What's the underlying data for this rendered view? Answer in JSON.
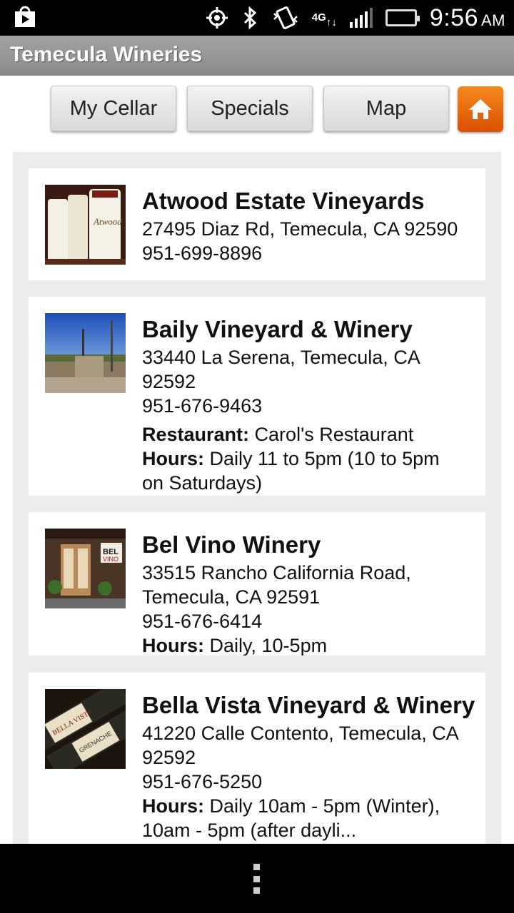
{
  "status_bar": {
    "time": "9:56",
    "ampm": "AM",
    "network": "4G",
    "icons": [
      "play-store-icon",
      "gps-icon",
      "bluetooth-icon",
      "vibrate-icon",
      "4g-icon",
      "signal-icon",
      "battery-icon"
    ],
    "battery_color": "#46c11d"
  },
  "app": {
    "title": "Temecula Wineries"
  },
  "toolbar": {
    "my_cellar": "My Cellar",
    "specials": "Specials",
    "map": "Map",
    "home_icon": "home-icon",
    "home_color": "#e8650c"
  },
  "wineries": [
    {
      "name": "Atwood Estate Vineyards",
      "address_line1": "27495 Diaz Rd, Temecula, CA 92590",
      "phone": "951-699-8896"
    },
    {
      "name": "Baily Vineyard & Winery",
      "address_line1": "33440 La Serena, Temecula, CA",
      "address_line2": "92592",
      "phone": "951-676-9463",
      "restaurant_label": "Restaurant:",
      "restaurant": "Carol's Restaurant",
      "hours_label": "Hours:",
      "hours_line1": "Daily 11 to 5pm (10 to 5pm",
      "hours_line2": "on Saturdays)"
    },
    {
      "name": "Bel Vino Winery",
      "address_line1": "33515 Rancho California Road,",
      "address_line2": "Temecula, CA 92591",
      "phone": "951-676-6414",
      "hours_label": "Hours:",
      "hours_line1": "Daily, 10-5pm"
    },
    {
      "name": "Bella Vista Vineyard & Winery",
      "address_line1": "41220 Calle Contento, Temecula, CA",
      "address_line2": "92592",
      "phone": "951-676-5250",
      "hours_label": "Hours:",
      "hours_line1": "Daily 10am - 5pm (Winter),",
      "hours_line2": "10am - 5pm (after dayli..."
    }
  ],
  "nav": {
    "menu_icon": "menu-icon"
  }
}
